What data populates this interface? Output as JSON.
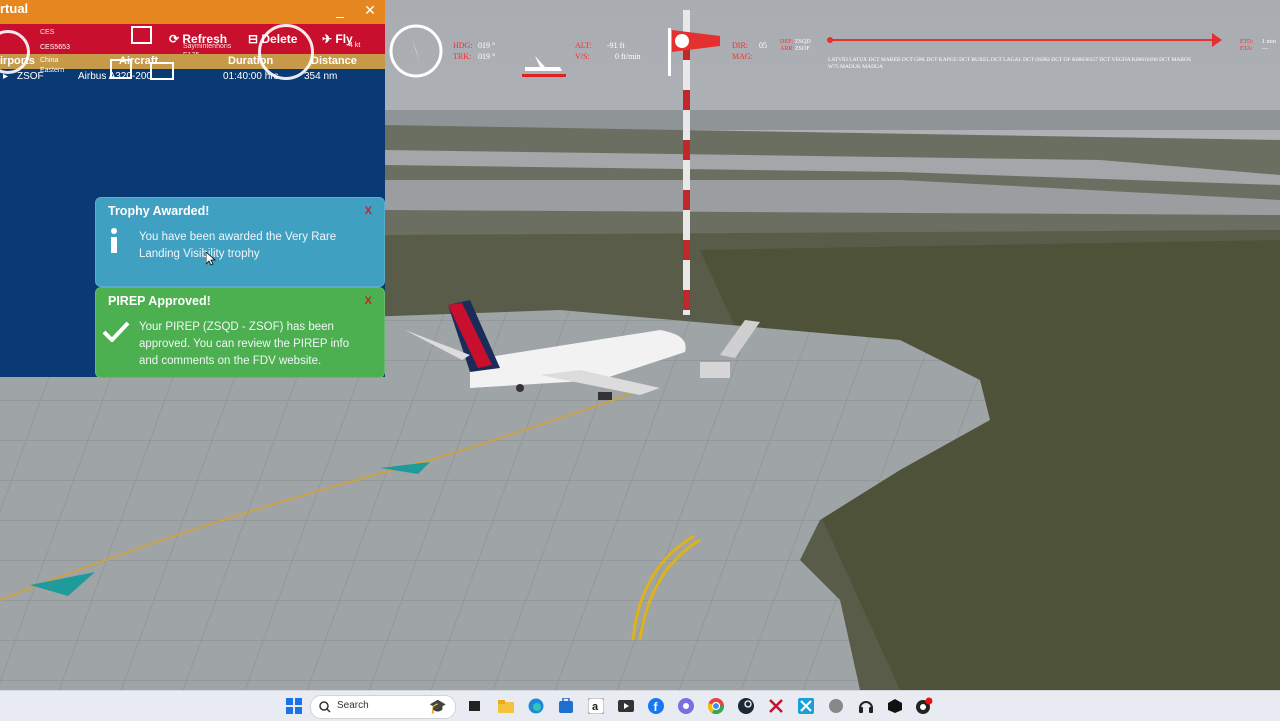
{
  "app": {
    "title": "rtual",
    "minimize_glyph": "_",
    "close_glyph": "✕",
    "toolbar": {
      "refresh_label": "Refresh",
      "delete_label": "Delete",
      "fly_label": "Fly",
      "refresh_sub": "Saymintenhons",
      "fly_sub": "4 kt",
      "flight_no": "CES5653",
      "airline_code": "CES",
      "airline_name_1": "China",
      "airline_name_2": "Eastern",
      "aircraft_type": "E175"
    },
    "table": {
      "headers": {
        "airports": "irports",
        "aircraft": "Aircraft",
        "duration": "Duration",
        "distance": "Distance"
      },
      "row": {
        "route": "ZSOF",
        "aircraft": "Airbus A320-200",
        "duration": "01:40:00 hrs",
        "distance": "354 nm"
      }
    }
  },
  "toasts": [
    {
      "title": "Trophy Awarded!",
      "close": "X",
      "message": "You have been awarded the Very Rare Landing Visibility trophy",
      "icon": "info-icon",
      "color": "#3fa0c2"
    },
    {
      "title": "PIREP Approved!",
      "close": "X",
      "message": "Your PIREP (ZSQD - ZSOF) has been approved. You can review the PIREP info and comments on the FDV website.",
      "icon": "checkmark-icon",
      "color": "#4caf50"
    }
  ],
  "hud": {
    "hdg_label": "HDG:",
    "hdg_value": "019 °",
    "trk_label": "TRK:",
    "trk_value": "019 °",
    "alt_label": "ALT:",
    "alt_value": "-91 ft",
    "vs_label": "V/S:",
    "vs_value": "0 ft/min",
    "dir_label": "DIR:",
    "dir_value": "05",
    "mag_label": "MAG:",
    "dep_label": "DEP:",
    "dep_value": "ZSQD",
    "arr_label": "ARR:",
    "arr_value": "ZSOF",
    "eto_label": "ETO:",
    "eto_value": "1 min",
    "eta_label": "ETA:",
    "eta_value": "---",
    "route_line_1": "LATVID LATUX DCT MABEB DCT GPK DCT KAPGU DCT RUXEL DCT LAGAL DCT OSIKI DCT OF K08636157 DCT VEGDA K08616100 DCT MABOS",
    "route_line_2": "W75 MADUK MADUA"
  },
  "taskbar": {
    "search_placeholder": "Search",
    "icons": [
      "windows-start-icon",
      "search-icon",
      "task-view-icon",
      "file-explorer-icon",
      "edge-icon",
      "store-icon",
      "amazon-icon",
      "media-icon",
      "facebook-icon",
      "discord-icon",
      "chrome-icon",
      "steam-icon",
      "xplane-icon",
      "app-icon",
      "record-icon",
      "headset-icon",
      "box-icon",
      "obs-icon"
    ]
  },
  "colors": {
    "titlebar": "#e6861f",
    "toolbar": "#c8102e",
    "app_bg": "#0a3a73",
    "hud_red": "#ff2a2a"
  }
}
